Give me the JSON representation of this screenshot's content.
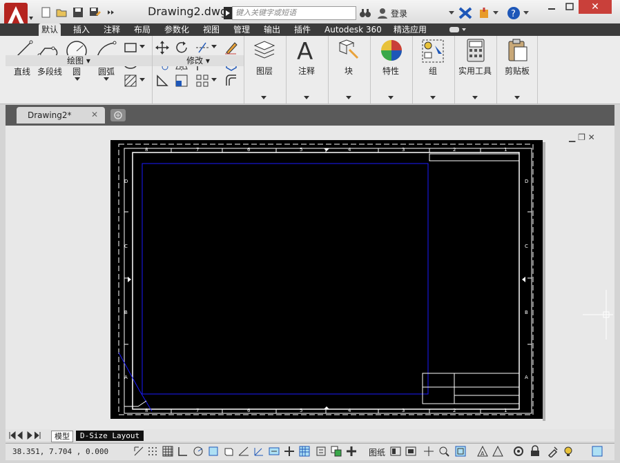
{
  "titlebar": {
    "doc_title": "Drawing2.dwg",
    "search_placeholder": "键入关键字或短语",
    "login": "登录"
  },
  "ribbon_tabs": [
    "默认",
    "插入",
    "注释",
    "布局",
    "参数化",
    "视图",
    "管理",
    "输出",
    "插件",
    "Autodesk 360",
    "精选应用"
  ],
  "active_tab": "默认",
  "draw_panel": {
    "title": "绘图",
    "tools": [
      "直线",
      "多段线",
      "圆",
      "圆弧"
    ]
  },
  "modify_panel": {
    "title": "修改"
  },
  "big_panels": [
    "图层",
    "注释",
    "块",
    "特性",
    "组",
    "实用工具",
    "剪贴板"
  ],
  "file_tab": {
    "label": "Drawing2*"
  },
  "layout_tabs": {
    "model": "模型",
    "layout": "D-Size Layout"
  },
  "status": {
    "coords": "38.351, 7.704 , 0.000",
    "paper": "图纸"
  },
  "sheet": {
    "col_labels": [
      "8",
      "7",
      "6",
      "5",
      "4",
      "3",
      "2",
      "1"
    ],
    "row_labels": [
      "D",
      "C",
      "B",
      "A"
    ]
  },
  "colors": {
    "accent_red": "#c9403a",
    "tab_dark": "#3b3b3b",
    "viewport_blue": "#1a1aff"
  }
}
